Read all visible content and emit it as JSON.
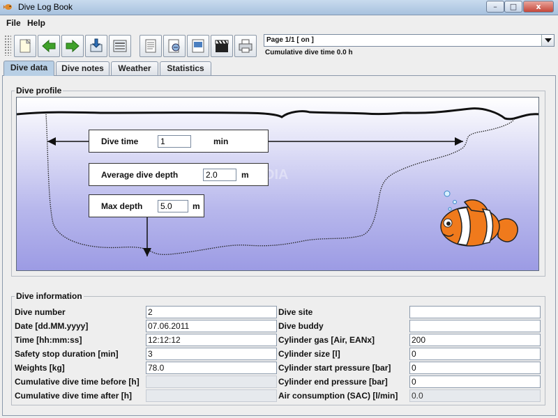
{
  "window": {
    "title": "Dive Log Book",
    "close": "x",
    "max": "□",
    "min": "–"
  },
  "menu": {
    "file": "File",
    "help": "Help"
  },
  "toolbar": {
    "buttons": [
      {
        "icon": "new-document-icon"
      },
      {
        "icon": "arrow-left-icon"
      },
      {
        "icon": "arrow-right-icon"
      },
      {
        "icon": "import-icon"
      },
      {
        "icon": "print-preview-icon"
      },
      {
        "icon": "notes-icon"
      },
      {
        "icon": "weather-icon"
      },
      {
        "icon": "picture-icon"
      },
      {
        "icon": "clapperboard-icon"
      },
      {
        "icon": "printer-icon"
      }
    ],
    "page_selector": "Page 1/1 [ on ]",
    "cumulative": "Cumulative dive time 0.0 h"
  },
  "tabs": [
    "Dive data",
    "Dive notes",
    "Weather",
    "Statistics"
  ],
  "profile": {
    "title": "Dive profile",
    "dive_time_label": "Dive time",
    "dive_time_value": "1",
    "dive_time_unit": "min",
    "avg_depth_label": "Average dive depth",
    "avg_depth_value": "2.0",
    "avg_depth_unit": "m",
    "max_depth_label": "Max depth",
    "max_depth_value": "5.0",
    "max_depth_unit": "m"
  },
  "info": {
    "title": "Dive information",
    "left": [
      {
        "label": "Dive number",
        "value": "2",
        "readonly": false
      },
      {
        "label": "Date [dd.MM.yyyy]",
        "value": "07.06.2011",
        "readonly": false
      },
      {
        "label": "Time [hh:mm:ss]",
        "value": "12:12:12",
        "readonly": false
      },
      {
        "label": "Safety stop duration [min]",
        "value": "3",
        "readonly": false
      },
      {
        "label": "Weights [kg]",
        "value": "78.0",
        "readonly": false
      },
      {
        "label": "Cumulative dive time before [h]",
        "value": "",
        "readonly": true
      },
      {
        "label": "Cumulative dive time after [h]",
        "value": "",
        "readonly": true
      }
    ],
    "right": [
      {
        "label": "Dive site",
        "value": "",
        "readonly": false
      },
      {
        "label": "Dive buddy",
        "value": "",
        "readonly": false
      },
      {
        "label": "Cylinder gas [Air, EANx]",
        "value": "200",
        "readonly": false
      },
      {
        "label": "Cylinder size [l]",
        "value": "0",
        "readonly": false
      },
      {
        "label": "Cylinder start pressure [bar]",
        "value": "0",
        "readonly": false
      },
      {
        "label": "Cylinder end pressure [bar]",
        "value": "0",
        "readonly": false
      },
      {
        "label": "Air consumption (SAC) [l/min]",
        "value": "0.0",
        "readonly": true
      }
    ]
  },
  "colors": {
    "tab_active": "#b8cfe5",
    "water_dark": "#9c9be4",
    "fish_orange": "#f07a1c"
  }
}
